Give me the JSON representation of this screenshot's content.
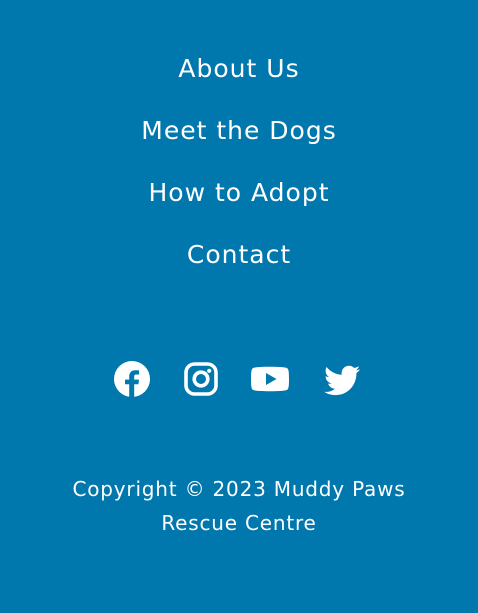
{
  "nav": {
    "items": [
      {
        "label": "About Us"
      },
      {
        "label": "Meet the Dogs"
      },
      {
        "label": "How to Adopt"
      },
      {
        "label": "Contact"
      }
    ]
  },
  "social": {
    "icons": [
      "facebook-icon",
      "instagram-icon",
      "youtube-icon",
      "twitter-icon"
    ]
  },
  "copyright": {
    "text": "Copyright © 2023 Muddy Paws Rescue Centre"
  },
  "colors": {
    "background": "#0077ad",
    "foreground": "#ffffff"
  }
}
